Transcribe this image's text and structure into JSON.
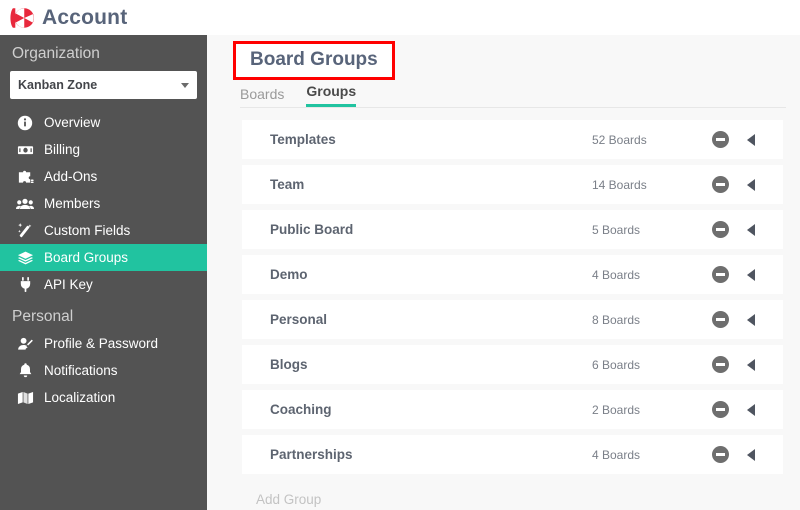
{
  "header": {
    "logo_icon": "kanbanzone-logo-icon",
    "title": "Account"
  },
  "sidebar": {
    "sections": [
      {
        "label": "Organization",
        "selector": {
          "value": "Kanban Zone",
          "icon": "chevron-down-icon"
        },
        "items": [
          {
            "label": "Overview",
            "icon": "info-circle-icon",
            "active": false
          },
          {
            "label": "Billing",
            "icon": "banknote-icon",
            "active": false
          },
          {
            "label": "Add-Ons",
            "icon": "puzzle-piece-icon",
            "active": false
          },
          {
            "label": "Members",
            "icon": "users-icon",
            "active": false
          },
          {
            "label": "Custom Fields",
            "icon": "magic-wand-icon",
            "active": false
          },
          {
            "label": "Board Groups",
            "icon": "layers-icon",
            "active": true
          },
          {
            "label": "API Key",
            "icon": "plug-icon",
            "active": false
          }
        ]
      },
      {
        "label": "Personal",
        "selector": null,
        "items": [
          {
            "label": "Profile & Password",
            "icon": "user-edit-icon",
            "active": false
          },
          {
            "label": "Notifications",
            "icon": "bell-icon",
            "active": false
          },
          {
            "label": "Localization",
            "icon": "map-icon",
            "active": false
          }
        ]
      }
    ]
  },
  "main": {
    "page_title": "Board Groups",
    "tabs": [
      {
        "label": "Boards",
        "active": false
      },
      {
        "label": "Groups",
        "active": true
      }
    ],
    "rows": [
      {
        "name": "Templates",
        "count": "52 Boards",
        "remove_icon": "minus-circle-icon",
        "collapse_icon": "triangle-left-icon"
      },
      {
        "name": "Team",
        "count": "14 Boards",
        "remove_icon": "minus-circle-icon",
        "collapse_icon": "triangle-left-icon"
      },
      {
        "name": "Public Board",
        "count": "5 Boards",
        "remove_icon": "minus-circle-icon",
        "collapse_icon": "triangle-left-icon"
      },
      {
        "name": "Demo",
        "count": "4 Boards",
        "remove_icon": "minus-circle-icon",
        "collapse_icon": "triangle-left-icon"
      },
      {
        "name": "Personal",
        "count": "8 Boards",
        "remove_icon": "minus-circle-icon",
        "collapse_icon": "triangle-left-icon"
      },
      {
        "name": "Blogs",
        "count": "6 Boards",
        "remove_icon": "minus-circle-icon",
        "collapse_icon": "triangle-left-icon"
      },
      {
        "name": "Coaching",
        "count": "2 Boards",
        "remove_icon": "minus-circle-icon",
        "collapse_icon": "triangle-left-icon"
      },
      {
        "name": "Partnerships",
        "count": "4 Boards",
        "remove_icon": "minus-circle-icon",
        "collapse_icon": "triangle-left-icon"
      }
    ],
    "add_group_placeholder": "Add Group"
  },
  "colors": {
    "accent_teal": "#21c3a0",
    "sidebar_bg": "#535353",
    "brand_red": "#e8283c",
    "highlight_box": "#ff0000",
    "title_text": "#58647a"
  }
}
